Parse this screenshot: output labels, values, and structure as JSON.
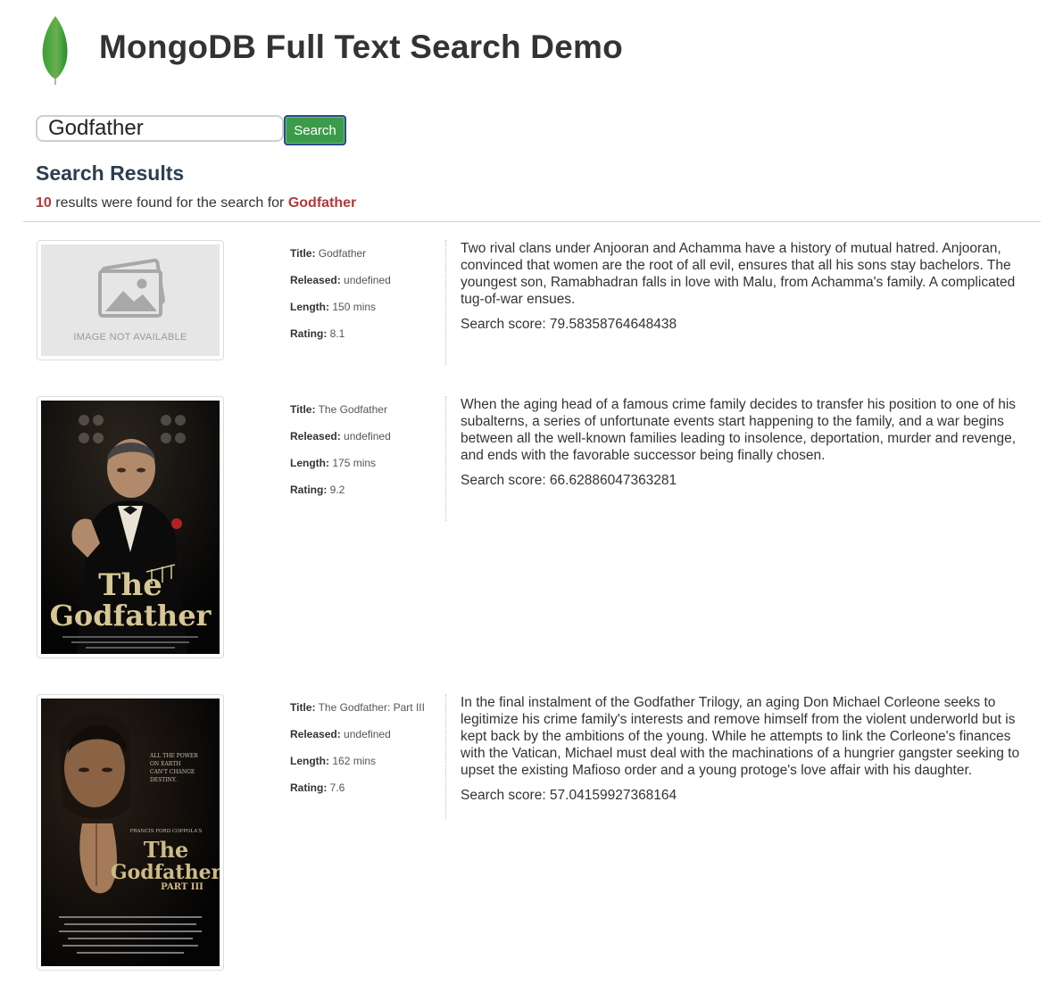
{
  "header": {
    "app_title": "MongoDB Full Text Search Demo",
    "logo_icon": "mongodb-leaf-icon"
  },
  "search": {
    "value": "Godfather",
    "button_label": "Search"
  },
  "results": {
    "heading": "Search Results",
    "count": "10",
    "summary_text": "results were found for the search for",
    "query": "Godfather",
    "labels": {
      "title": "Title:",
      "released": "Released:",
      "length": "Length:",
      "rating": "Rating:"
    },
    "items": [
      {
        "title": "Godfather",
        "released": "undefined",
        "length": "150 mins",
        "rating": "8.1",
        "poster": "image-not-available-placeholder",
        "poster_caption": "IMAGE NOT AVAILABLE",
        "description": "Two rival clans under Anjooran and Achamma have a history of mutual hatred. Anjooran, convinced that women are the root of all evil, ensures that all his sons stay bachelors. The youngest son, Ramabhadran falls in love with Malu, from Achamma's family. A complicated tug-of-war ensues.",
        "score": "Search score: 79.58358764648438"
      },
      {
        "title": "The Godfather",
        "released": "undefined",
        "length": "175 mins",
        "rating": "9.2",
        "poster": "the-godfather-poster",
        "description": "When the aging head of a famous crime family decides to transfer his position to one of his subalterns, a series of unfortunate events start happening to the family, and a war begins between all the well-known families leading to insolence, deportation, murder and revenge, and ends with the favorable successor being finally chosen.",
        "score": "Search score: 66.62886047363281"
      },
      {
        "title": "The Godfather: Part III",
        "released": "undefined",
        "length": "162 mins",
        "rating": "7.6",
        "poster": "the-godfather-part-iii-poster",
        "description": "In the final instalment of the Godfather Trilogy, an aging Don Michael Corleone seeks to legitimize his crime family's interests and remove himself from the violent underworld but is kept back by the ambitions of the young. While he attempts to link the Corleone's finances with the Vatican, Michael must deal with the machinations of a hungrier gangster seeking to upset the existing Mafioso order and a young protoge's love affair with his daughter.",
        "score": "Search score: 57.04159927368164"
      }
    ]
  }
}
